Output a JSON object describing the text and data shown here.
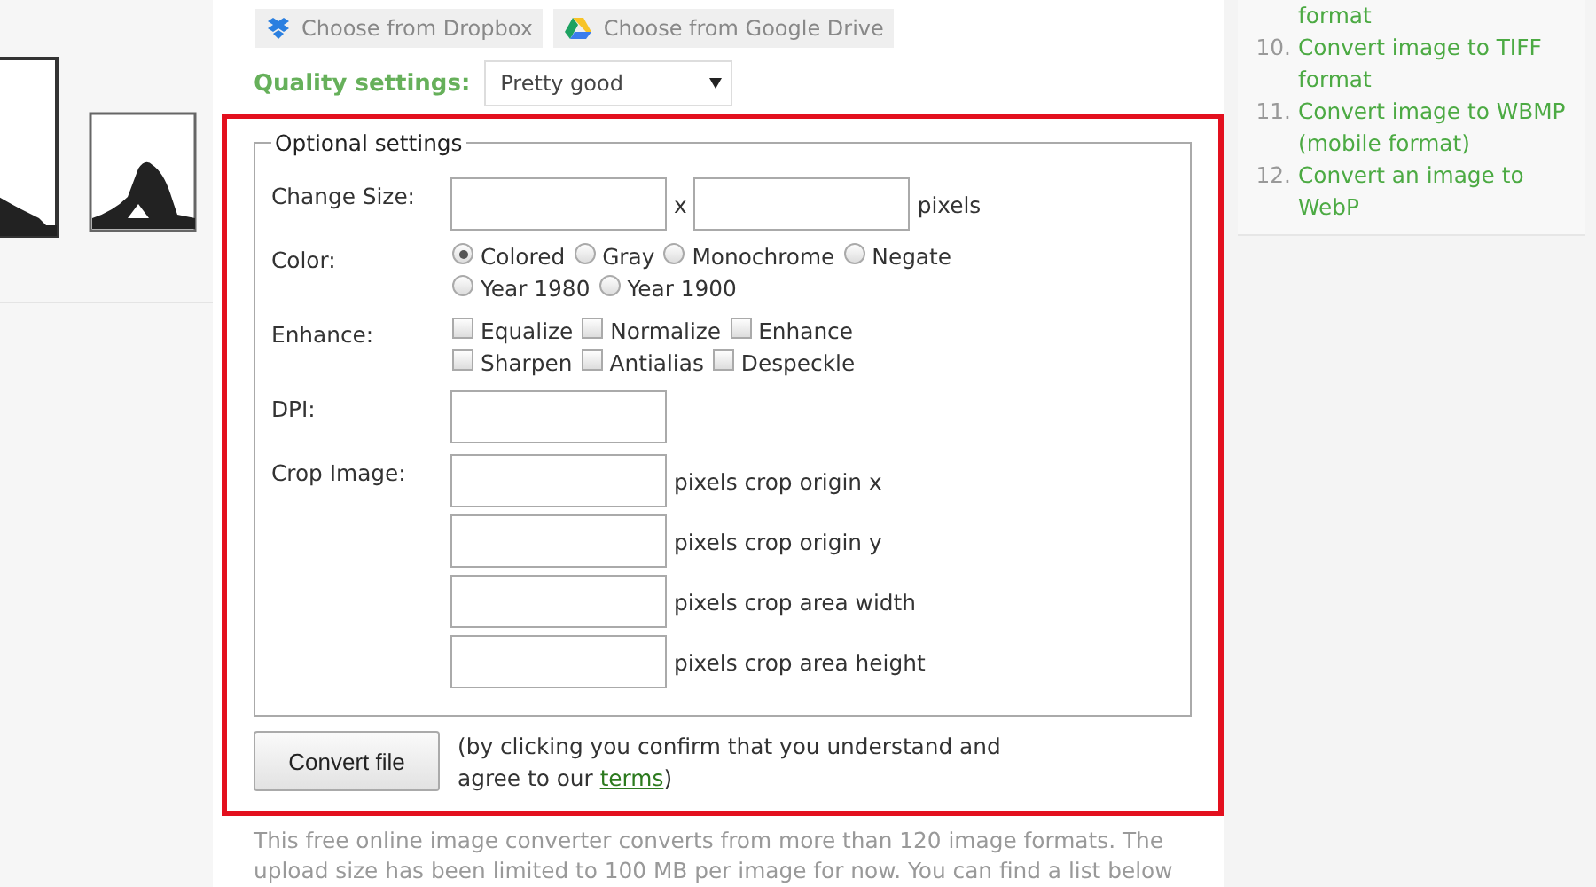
{
  "cloud_buttons": [
    {
      "kind": "dropbox",
      "label": "Choose from Dropbox"
    },
    {
      "kind": "gdrive",
      "label": "Choose from Google Drive"
    }
  ],
  "quality": {
    "label": "Quality settings:",
    "value": "Pretty good"
  },
  "optional": {
    "legend": "Optional settings",
    "size": {
      "label": "Change Size:",
      "separator": "x",
      "unit": "pixels"
    },
    "color": {
      "label": "Color:",
      "options": [
        {
          "label": "Colored",
          "selected": true
        },
        {
          "label": "Gray",
          "selected": false
        },
        {
          "label": "Monochrome",
          "selected": false
        },
        {
          "label": "Negate",
          "selected": false
        },
        {
          "label": "Year 1980",
          "selected": false
        },
        {
          "label": "Year 1900",
          "selected": false
        }
      ]
    },
    "enhance": {
      "label": "Enhance:",
      "options": [
        {
          "label": "Equalize",
          "checked": false
        },
        {
          "label": "Normalize",
          "checked": false
        },
        {
          "label": "Enhance",
          "checked": false
        },
        {
          "label": "Sharpen",
          "checked": false
        },
        {
          "label": "Antialias",
          "checked": false
        },
        {
          "label": "Despeckle",
          "checked": false
        }
      ]
    },
    "dpi": {
      "label": "DPI:"
    },
    "crop": {
      "label": "Crop Image:",
      "fields": [
        "pixels crop origin x",
        "pixels crop origin y",
        "pixels crop area width",
        "pixels crop area height"
      ]
    }
  },
  "submit": {
    "button": "Convert file",
    "note_before": "(by clicking you confirm that you understand and agree to our ",
    "link": "terms",
    "note_after": ")"
  },
  "intro": "This free online image converter converts from more than 120 image formats. The upload size has been limited to 100 MB per image for now. You can find a list below",
  "sidebar": [
    {
      "text": "format"
    },
    {
      "number": "10.",
      "text": "Convert image to TIFF format"
    },
    {
      "number": "11.",
      "text": "Convert image to WBMP (mobile format)"
    },
    {
      "number": "12.",
      "text": "Convert an image to WebP"
    }
  ]
}
